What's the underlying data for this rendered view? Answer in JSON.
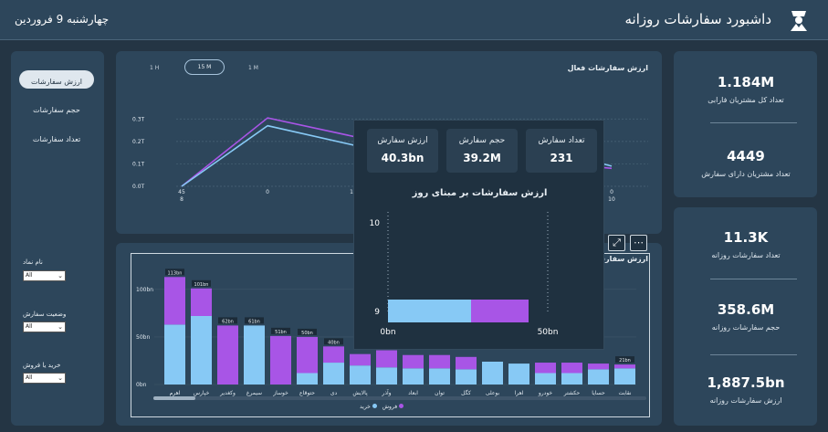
{
  "header": {
    "title": "داشبورد سفارشات روزانه",
    "date": "چهارشنبه 9 فروردین"
  },
  "colors": {
    "buy": "#87c9f5",
    "sell": "#a855e6"
  },
  "nav": {
    "active": "ارزش سفارشات",
    "items": [
      "حجم سفارشات",
      "تعداد سفارشات"
    ]
  },
  "filters": [
    {
      "label": "نام نماد",
      "value": "All"
    },
    {
      "label": "وضعیت سفارش",
      "value": "All"
    },
    {
      "label": "خرید یا فروش",
      "value": "All"
    }
  ],
  "kpis_top": [
    {
      "value": "1.184M",
      "label": "تعداد کل مشتریان فارابی"
    },
    {
      "value": "4449",
      "label": "تعداد مشتریان دارای سفارش"
    }
  ],
  "kpis_bottom": [
    {
      "value": "11.3K",
      "label": "تعداد سفارشات روزانه"
    },
    {
      "value": "358.6M",
      "label": "حجم سفارشات روزانه"
    },
    {
      "value": "1,887.5bn",
      "label": "ارزش سفارشات روزانه"
    }
  ],
  "line_section": {
    "title": "ارزش سفارشات فعال",
    "toggles": [
      "1 H",
      "15 M",
      "1 M"
    ],
    "active_toggle": "15 M"
  },
  "bar_section": {
    "title": "ارزش سفارشا",
    "legend": [
      "فروش",
      "خرید"
    ]
  },
  "popup": {
    "kpis": [
      {
        "label": "ارزش سفارش",
        "value": "40.3bn"
      },
      {
        "label": "حجم سفارش",
        "value": "39.2M"
      },
      {
        "label": "تعداد سفارش",
        "value": "231"
      }
    ],
    "chart_title": "ارزش سفارشات بر مبنای روز"
  },
  "chart_data": [
    {
      "type": "line",
      "x": [
        "45\n8",
        "0",
        "10",
        "0\n10"
      ],
      "yticks": [
        "0.0T",
        "0.1T",
        "0.2T",
        "0.3T"
      ],
      "ylim": [
        0,
        0.35
      ],
      "series": [
        {
          "points": [
            [
              0,
              0.0
            ],
            [
              0.2,
              0.305
            ],
            [
              0.55,
              0.16
            ],
            [
              1.0,
              0.08
            ]
          ]
        },
        {
          "points": [
            [
              0,
              0.0
            ],
            [
              0.2,
              0.27
            ],
            [
              0.42,
              0.175
            ],
            [
              0.62,
              0.285
            ],
            [
              1.0,
              0.09
            ]
          ]
        }
      ]
    },
    {
      "type": "bar",
      "categories": [
        "اهرم",
        "خپارس",
        "وکغدیر",
        "سیمرغ",
        "خوساز",
        "حتوقاع",
        "دی",
        "پالایش",
        "وآذر",
        "ابعاد",
        "توان",
        "کگل",
        "بوعلی",
        "اهرا",
        "خودرو",
        "حکشتر",
        "حسایا",
        "نقابت"
      ],
      "series": [
        {
          "name": "خرید",
          "values": [
            63,
            72,
            0,
            62,
            0,
            12,
            23,
            20,
            18,
            17,
            17,
            16,
            24,
            22,
            12,
            12,
            16,
            17
          ]
        },
        {
          "name": "فروش",
          "values": [
            50,
            29,
            62,
            0,
            51,
            38,
            17,
            12,
            18,
            14,
            14,
            13,
            0,
            0,
            11,
            11,
            6,
            4
          ]
        }
      ],
      "data_labels": [
        "113bn",
        "101bn",
        "62bn",
        "61bn",
        "51bn",
        "50bn",
        "40bn",
        "",
        "",
        "",
        "",
        "",
        "",
        "",
        "",
        "",
        "",
        "21bn"
      ],
      "yticks": [
        "0bn",
        "50bn",
        "100bn"
      ],
      "ylim": [
        0,
        120
      ]
    },
    {
      "type": "bar",
      "orientation": "horizontal",
      "categories": [
        "10",
        "9"
      ],
      "series": [
        {
          "name": "خرید",
          "values": [
            0,
            26
          ]
        },
        {
          "name": "فروش",
          "values": [
            0,
            18
          ]
        }
      ],
      "xticks": [
        "0bn",
        "50bn"
      ],
      "xlim": [
        0,
        50
      ]
    }
  ]
}
